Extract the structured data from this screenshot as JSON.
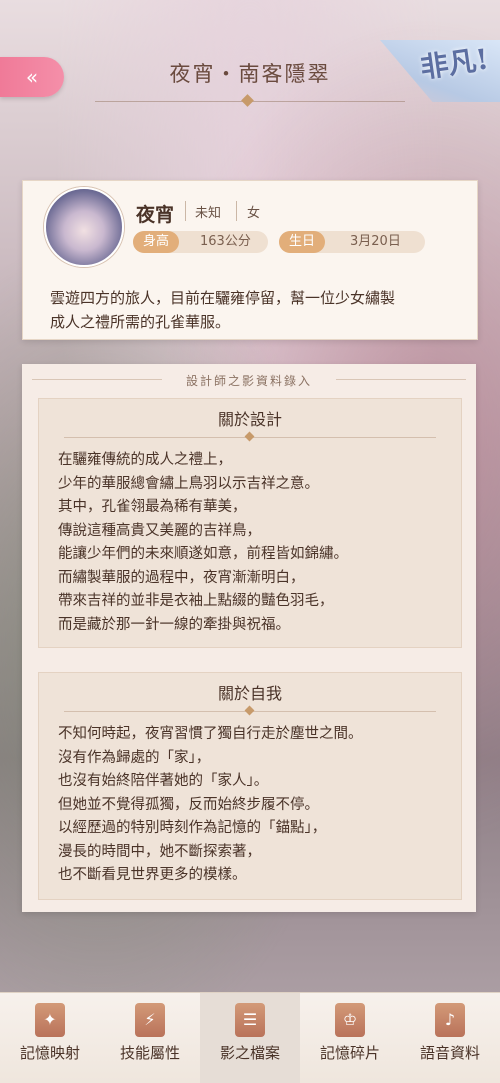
{
  "header": {
    "back_icon": "double-chevron-left-icon",
    "back_glyph": "«",
    "title": "夜宵・南客隱翠",
    "rarity": "非凡!"
  },
  "profile": {
    "name": "夜宵",
    "tag1": "未知",
    "tag2": "女",
    "height_label": "身高",
    "height_value": "163公分",
    "birthday_label": "生日",
    "birthday_value": "3月20日",
    "bio_lines": [
      "雲遊四方的旅人，目前在驪雍停留，幫一位少女繡製",
      "成人之禮所需的孔雀華服。"
    ]
  },
  "record": {
    "header": "設計師之影資料錄入",
    "sections": [
      {
        "title": "關於設計",
        "lines": [
          "在驪雍傳統的成人之禮上，",
          "少年的華服總會繡上鳥羽以示吉祥之意。",
          "其中，孔雀翎最為稀有華美，",
          "傳說這種高貴又美麗的吉祥鳥，",
          "能讓少年們的未來順遂如意，前程皆如錦繡。",
          "而繡製華服的過程中，夜宵漸漸明白，",
          "帶來吉祥的並非是衣袖上點綴的豔色羽毛，",
          "而是藏於那一針一線的牽掛與祝福。"
        ]
      },
      {
        "title": "關於自我",
        "lines": [
          "不知何時起，夜宵習慣了獨自行走於塵世之間。",
          "沒有作為歸處的「家」，",
          "也沒有始終陪伴著她的「家人」。",
          "但她並不覺得孤獨，反而始終步履不停。",
          "以經歷過的特別時刻作為記憶的「錨點」，",
          "漫長的時間中，她不斷探索著，",
          "也不斷看見世界更多的模樣。"
        ]
      }
    ]
  },
  "tabbar": {
    "tabs": [
      {
        "label": "記憶映射",
        "icon": "card-icon",
        "glyph": "✦"
      },
      {
        "label": "技能屬性",
        "icon": "lightning-shield-icon",
        "glyph": "⚡"
      },
      {
        "label": "影之檔案",
        "icon": "document-icon",
        "glyph": "☰"
      },
      {
        "label": "記憶碎片",
        "icon": "dress-icon",
        "glyph": "♔"
      },
      {
        "label": "語音資料",
        "icon": "phone-audio-icon",
        "glyph": "♪"
      }
    ],
    "active_index": 2
  }
}
